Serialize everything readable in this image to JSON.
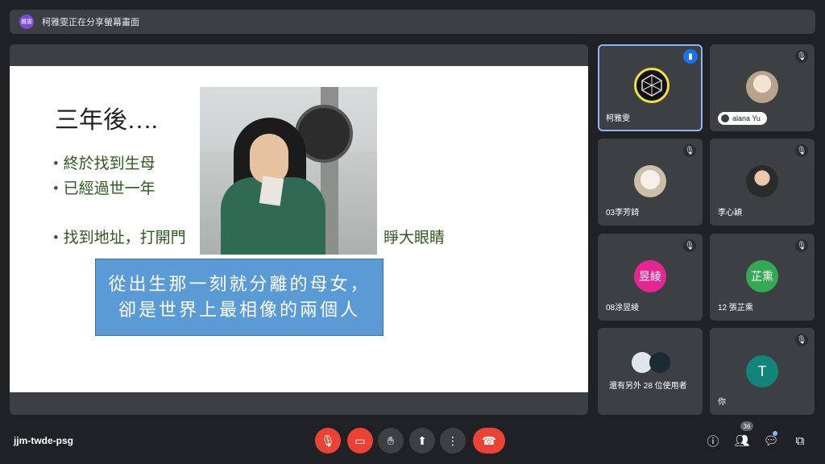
{
  "topbar": {
    "presenter_initials": "雅雯",
    "presenting_text": "柯雅雯正在分享螢幕畫面"
  },
  "slide": {
    "title": "三年後….",
    "bullets": [
      "終於找到生母",
      "已經過世一年",
      "找到地址，打開門",
      "睜大眼睛"
    ],
    "caption_line1": "從出生那一刻就分離的母女，",
    "caption_line2": "卻是世界上最相像的兩個人"
  },
  "participants": {
    "p1": {
      "name": "柯雅雯",
      "status_icon": "speaking-icon"
    },
    "p2": {
      "name": "alana Yu",
      "status_icon": "mic-off-icon"
    },
    "p3": {
      "name": "03李芳錡",
      "status_icon": "mic-off-icon"
    },
    "p4": {
      "name": "李心穎",
      "status_icon": "mic-off-icon"
    },
    "p5": {
      "name": "08涂昱綾",
      "initials": "昱綾",
      "avatar_color": "#e52592",
      "status_icon": "mic-off-icon"
    },
    "p6": {
      "name": "12 張芷熏",
      "initials": "芷熏",
      "avatar_color": "#34a853",
      "status_icon": "mic-off-icon"
    },
    "p7": {
      "name": "還有另外 28 位使用者"
    },
    "p8": {
      "name": "你",
      "initials": "T",
      "avatar_color": "#12857a",
      "status_icon": "mic-off-icon"
    }
  },
  "bottom": {
    "meeting_code": "jjm-twde-psg",
    "people_count": "36"
  },
  "colors": {
    "mic_off_red": "#ea4335",
    "active_speaker_blue": "#8ab4f8",
    "caption_blue": "#5b9bd5"
  }
}
